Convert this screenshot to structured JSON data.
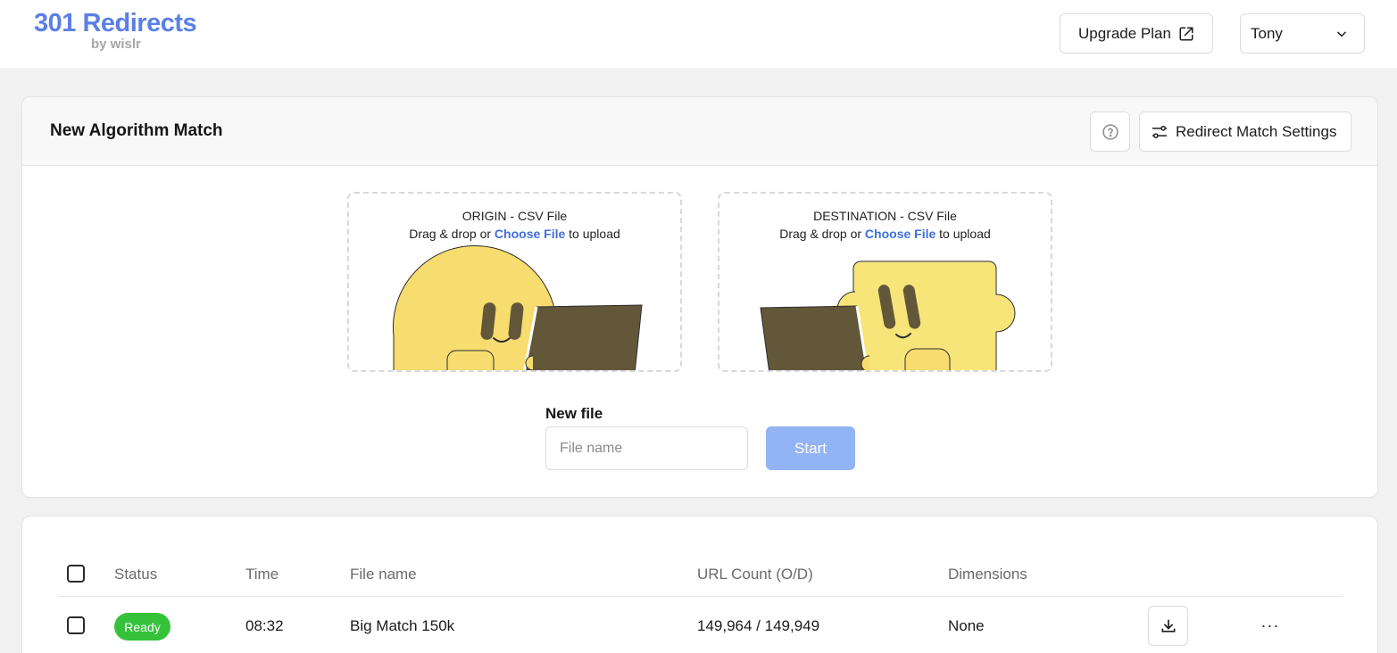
{
  "header": {
    "logo_main": "301 Redirects",
    "logo_sub": "by wislr",
    "upgrade_label": "Upgrade Plan",
    "user_name": "Tony"
  },
  "match_panel": {
    "title": "New Algorithm Match",
    "settings_label": "Redirect Match Settings",
    "origin": {
      "title": "ORIGIN - CSV File",
      "sub_prefix": "Drag & drop or ",
      "link": "Choose File",
      "sub_suffix": " to upload"
    },
    "destination": {
      "title": "DESTINATION - CSV File",
      "sub_prefix": "Drag & drop or ",
      "link": "Choose File",
      "sub_suffix": " to upload"
    },
    "new_file_label": "New file",
    "file_input_placeholder": "File name",
    "file_input_value": "",
    "start_label": "Start"
  },
  "table": {
    "columns": [
      "Status",
      "Time",
      "File name",
      "URL Count (O/D)",
      "Dimensions"
    ],
    "rows": [
      {
        "status": "Ready",
        "time": "08:32",
        "file_name": "Big Match 150k",
        "url_count": "149,964 / 149,949",
        "dimensions": "None",
        "more": "···"
      }
    ]
  },
  "colors": {
    "brand": "#5b7fe6",
    "link": "#3f6fdc",
    "start_button": "#93b4f4",
    "ready_badge": "#35c23a",
    "mascot_yellow": "#f7dc6f",
    "laptop_brown": "#63573a"
  },
  "icons": {
    "upgrade": "external-link-icon",
    "user_menu": "chevron-down-icon",
    "help": "question-circle-icon",
    "settings": "sliders-icon",
    "download": "download-icon",
    "more": "more-horizontal-icon"
  }
}
